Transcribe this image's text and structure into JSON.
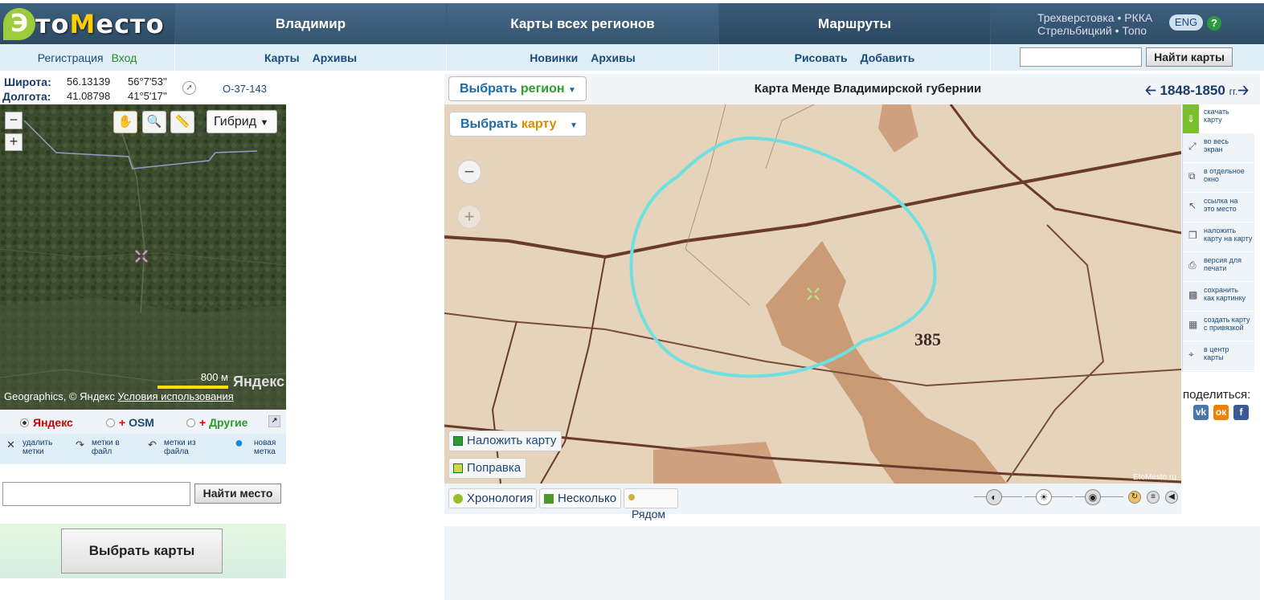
{
  "logo": {
    "mark": "Э",
    "text_a": "то",
    "text_b": "М",
    "text_c": "есто"
  },
  "nav": {
    "region": "Владимир",
    "all_maps": "Карты всех регионов",
    "routes": "Маршруты",
    "right_line1": "Трехверстовка • РККА",
    "right_line2": "Стрельбицкий • Топо",
    "lang": "ENG",
    "help": "?"
  },
  "subnav": {
    "register": "Регистрация",
    "login": "Вход",
    "maps": "Карты",
    "archives1": "Архивы",
    "news": "Новинки",
    "archives2": "Архивы",
    "draw": "Рисовать",
    "add": "Добавить",
    "find_maps": "Найти карты"
  },
  "coords": {
    "lat_label": "Широта:",
    "lat_dec": "56.13139",
    "lat_dms": "56°7'53''",
    "lon_label": "Долгота:",
    "lon_dec": "41.08798",
    "lon_dms": "41°5'17''",
    "sheet": "O-37-143"
  },
  "small_map": {
    "layer": "Гибрид",
    "scale": "800 м",
    "yandex": "Яндекс",
    "copyright": "Geographics, © Яндекс",
    "terms": "Условия использования"
  },
  "providers": {
    "yandex": "Яндекс",
    "osm": "OSM",
    "other": "Другие",
    "plus": "+"
  },
  "marks": {
    "delete": [
      "удалить",
      "метки"
    ],
    "to_file": [
      "метки в",
      "файл"
    ],
    "from_file": [
      "метки из",
      "файла"
    ],
    "new": [
      "новая",
      "метка"
    ]
  },
  "find_place": "Найти место",
  "choose_maps": "Выбрать карты",
  "main_map": {
    "select_region_a": "Выбрать",
    "select_region_b": "регион",
    "select_map_a": "Выбрать",
    "select_map_b": "карту",
    "title": "Карта Менде Владимирской губернии",
    "years": "1848-1850",
    "years_unit": "гг.",
    "overlay": "Наложить карту",
    "correction": "Поправка",
    "watermark": "EtoMesto.ru",
    "map_label": "385",
    "chronology": "Хронология",
    "several": "Несколько",
    "nearby": "Рядом"
  },
  "right_tools": [
    [
      "скачать",
      "карту"
    ],
    [
      "во весь",
      "экран"
    ],
    [
      "в отдельное",
      "окно"
    ],
    [
      "ссылка на",
      "это место"
    ],
    [
      "наложить",
      "карту на карту"
    ],
    [
      "версия для",
      "печати"
    ],
    [
      "сохранить",
      "как картинку"
    ],
    [
      "создать карту",
      "с привязкой"
    ],
    [
      "в центр",
      "карты"
    ]
  ],
  "share": {
    "label": "поделиться:",
    "vk": "vk",
    "ok": "ок",
    "fb": "f"
  },
  "colors": {
    "header": "#3b5b75",
    "accent": "#1a6aa8",
    "green": "#7cbf2c",
    "circle": "#6fe0e0"
  }
}
